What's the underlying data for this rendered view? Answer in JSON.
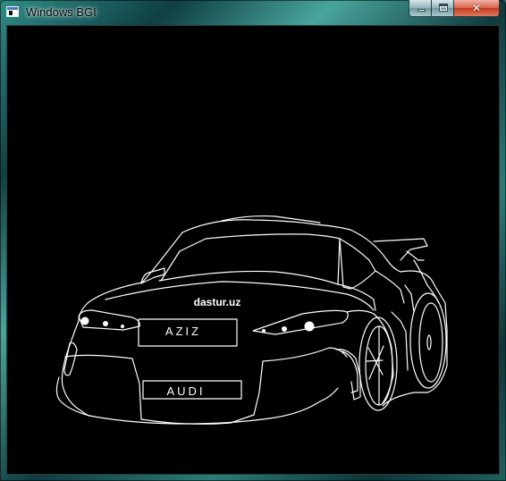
{
  "window": {
    "title": "Windows BGI",
    "close_symbol": "✕"
  },
  "icons": {
    "app": "window-app-icon",
    "minimize": "minimize-icon",
    "maximize": "maximize-icon",
    "close": "close-icon"
  },
  "canvas": {
    "watermark": "dastur.uz",
    "front_plate": "AZIZ",
    "lower_plate": "AUDI"
  },
  "colors": {
    "canvas_background": "#000000",
    "line_color": "#ffffff",
    "close_button": "#c7432a"
  }
}
